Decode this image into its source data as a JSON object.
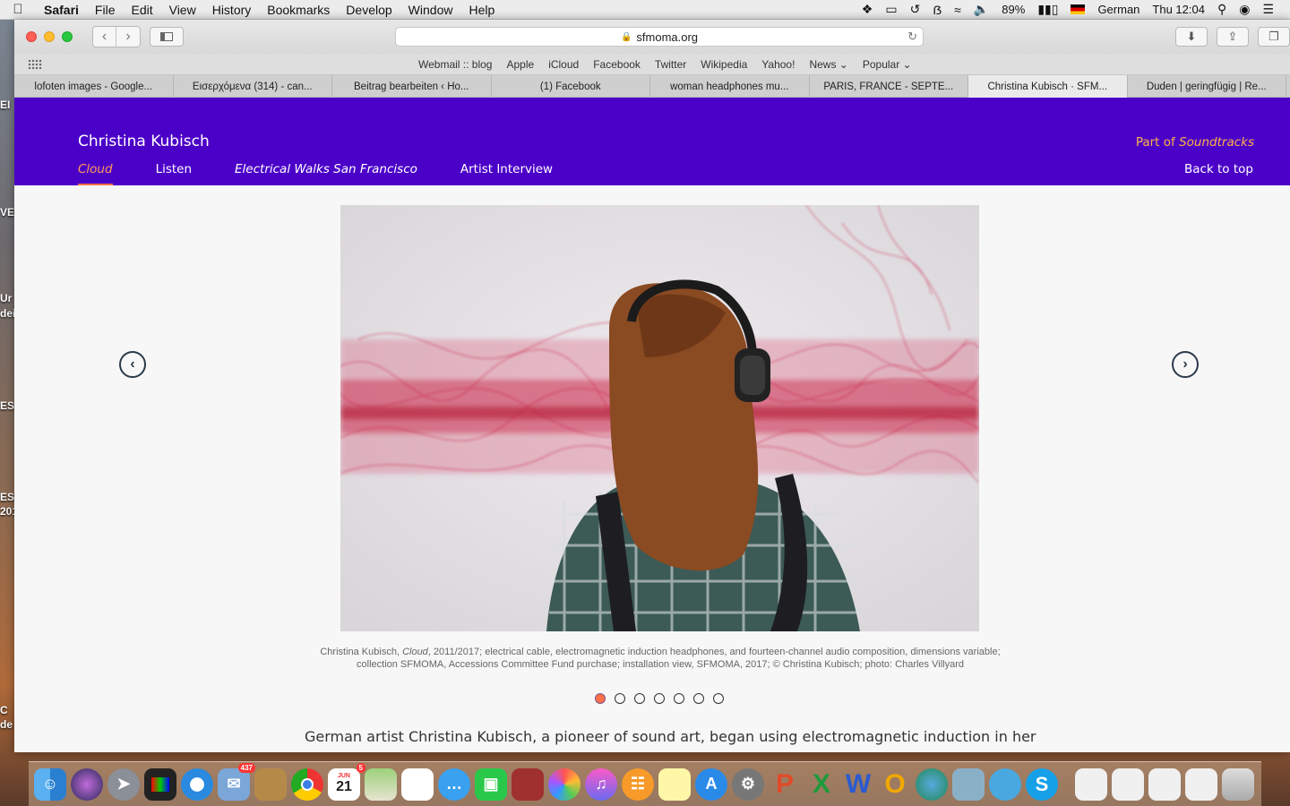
{
  "menubar": {
    "app": "Safari",
    "items": [
      "File",
      "Edit",
      "View",
      "History",
      "Bookmarks",
      "Develop",
      "Window",
      "Help"
    ],
    "battery": "89%",
    "input_language": "German",
    "clock": "Thu 12:04"
  },
  "desktop_labels": [
    "EI",
    "VEI",
    "Ur",
    "dei",
    "ES",
    "EST",
    "201",
    "C",
    "de"
  ],
  "browser": {
    "url": "sfmoma.org",
    "favorites": [
      "Webmail :: blog",
      "Apple",
      "iCloud",
      "Facebook",
      "Twitter",
      "Wikipedia",
      "Yahoo!",
      "News ⌄",
      "Popular ⌄"
    ],
    "tabs": [
      "lofoten images - Google...",
      "Εισερχόμενα (314) - can...",
      "Beitrag bearbeiten ‹ Ho...",
      "(1) Facebook",
      "woman headphones mu...",
      "PARIS, FRANCE - SEPTE...",
      "Christina Kubisch · SFM...",
      "Duden | geringfügig | Re..."
    ],
    "active_tab_index": 6
  },
  "site": {
    "artist": "Christina Kubisch",
    "nav": [
      "Cloud",
      "Listen",
      "Electrical Walks San Francisco",
      "Artist Interview"
    ],
    "part_of_prefix": "Part of",
    "part_of_link": "Soundtracks",
    "back_to_top": "Back to top",
    "caption_artist": "Christina Kubisch,",
    "caption_title": "Cloud",
    "caption_rest": ", 2011/2017; electrical cable, electromagnetic induction headphones, and fourteen-channel audio composition, dimensions variable; collection SFMOMA, Accessions Committee Fund purchase; installation view, SFMOMA, 2017; © Christina Kubisch; photo: Charles Villyard",
    "slide_count": 7,
    "active_slide": 1,
    "body_text": "German artist Christina Kubisch, a pioneer of sound art, began using electromagnetic induction in her"
  },
  "dock": {
    "icons": [
      "finder-icon",
      "siri-icon",
      "launchpad-icon",
      "photo-booth-icon",
      "safari-icon",
      "mail-icon",
      "notes-icon",
      "chrome-icon",
      "calendar-icon",
      "maps-icon",
      "reminders-icon",
      "messages-icon",
      "facetime-icon",
      "photo-app-icon",
      "photos-icon",
      "itunes-icon",
      "ibooks-icon",
      "stickies-icon",
      "app-store-icon",
      "system-preferences-icon",
      "powerpoint-icon",
      "excel-icon",
      "word-icon",
      "onenote-icon",
      "network-icon",
      "preview-icon",
      "contacts-icon",
      "skype-icon",
      "doc1-icon",
      "doc2-icon",
      "doc3-icon",
      "doc4-icon",
      "trash-icon"
    ],
    "mail_badge": "437",
    "calendar_day": "21",
    "calendar_month": "JUN",
    "calendar_badge": "5"
  },
  "colors": {
    "header_bg": "#4b00c8",
    "accent_orange": "#ff6f4a",
    "part_of_color": "#ffb347"
  }
}
